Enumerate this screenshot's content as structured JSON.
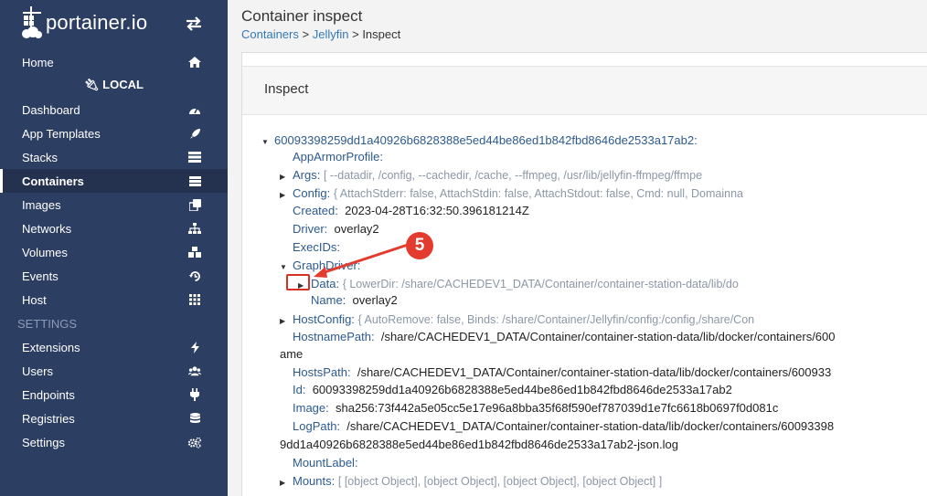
{
  "brand": {
    "name": "portainer.io"
  },
  "sidebar": {
    "home": "Home",
    "environment": "LOCAL",
    "items": [
      {
        "label": "Dashboard",
        "icon": "tachometer-icon"
      },
      {
        "label": "App Templates",
        "icon": "rocket-icon"
      },
      {
        "label": "Stacks",
        "icon": "stack-icon"
      },
      {
        "label": "Containers",
        "icon": "list-icon",
        "active": true
      },
      {
        "label": "Images",
        "icon": "clone-icon"
      },
      {
        "label": "Networks",
        "icon": "sitemap-icon"
      },
      {
        "label": "Volumes",
        "icon": "cubes-icon"
      },
      {
        "label": "Events",
        "icon": "history-icon"
      },
      {
        "label": "Host",
        "icon": "grid-icon"
      }
    ],
    "settings_header": "SETTINGS",
    "settings_items": [
      {
        "label": "Extensions",
        "icon": "bolt-icon"
      },
      {
        "label": "Users",
        "icon": "users-icon"
      },
      {
        "label": "Endpoints",
        "icon": "plug-icon"
      },
      {
        "label": "Registries",
        "icon": "database-icon"
      },
      {
        "label": "Settings",
        "icon": "cogs-icon"
      }
    ]
  },
  "header": {
    "title": "Container inspect",
    "breadcrumb": [
      "Containers",
      "Jellyfin",
      "Inspect"
    ]
  },
  "panel": {
    "title": "Inspect"
  },
  "inspect": {
    "root": "60093398259dd1a40926b6828388e5ed44be86ed1b842fbd8646de2533a17ab2:",
    "app_armor": "AppArmorProfile:",
    "args_key": "Args:",
    "args_val": "[ --datadir, /config, --cachedir, /cache, --ffmpeg, /usr/lib/jellyfin-ffmpeg/ffmpe",
    "config_key": "Config:",
    "config_val": "{ AttachStderr: false, AttachStdin: false, AttachStdout: false, Cmd: null, Domainna",
    "created_key": "Created:",
    "created_val": "2023-04-28T16:32:50.396181214Z",
    "driver_key": "Driver:",
    "driver_val": "overlay2",
    "execids_key": "ExecIDs:",
    "graphdriver_key": "GraphDriver:",
    "data_key": "Data:",
    "data_val": "{ LowerDir: /share/CACHEDEV1_DATA/Container/container-station-data/lib/do",
    "name_key": "Name:",
    "name_val": "overlay2",
    "hostconfig_key": "HostConfig:",
    "hostconfig_val": "{ AutoRemove: false, Binds: /share/Container/Jellyfin/config:/config,/share/Con",
    "hostnamepath_key": "HostnamePath:",
    "hostnamepath_val": "/share/CACHEDEV1_DATA/Container/container-station-data/lib/docker/containers/600",
    "hostnamepath_wrap": "ame",
    "hostspath_key": "HostsPath:",
    "hostspath_val": "/share/CACHEDEV1_DATA/Container/container-station-data/lib/docker/containers/600933",
    "id_key": "Id:",
    "id_val": "60093398259dd1a40926b6828388e5ed44be86ed1b842fbd8646de2533a17ab2",
    "image_key": "Image:",
    "image_val": "sha256:73f442a5e05cc5e17e96a8bba35f68f590ef787039d1e7fc6618b0697f0d081c",
    "logpath_key": "LogPath:",
    "logpath_val": "/share/CACHEDEV1_DATA/Container/container-station-data/lib/docker/containers/60093398",
    "logpath_wrap": "9dd1a40926b6828388e5ed44be86ed1b842fbd8646de2533a17ab2-json.log",
    "mountlabel_key": "MountLabel:",
    "mounts_key": "Mounts:",
    "mounts_val": "[ [object Object], [object Object], [object Object], [object Object] ]"
  },
  "annotation": {
    "step": "5",
    "color": "#e33b2e"
  }
}
